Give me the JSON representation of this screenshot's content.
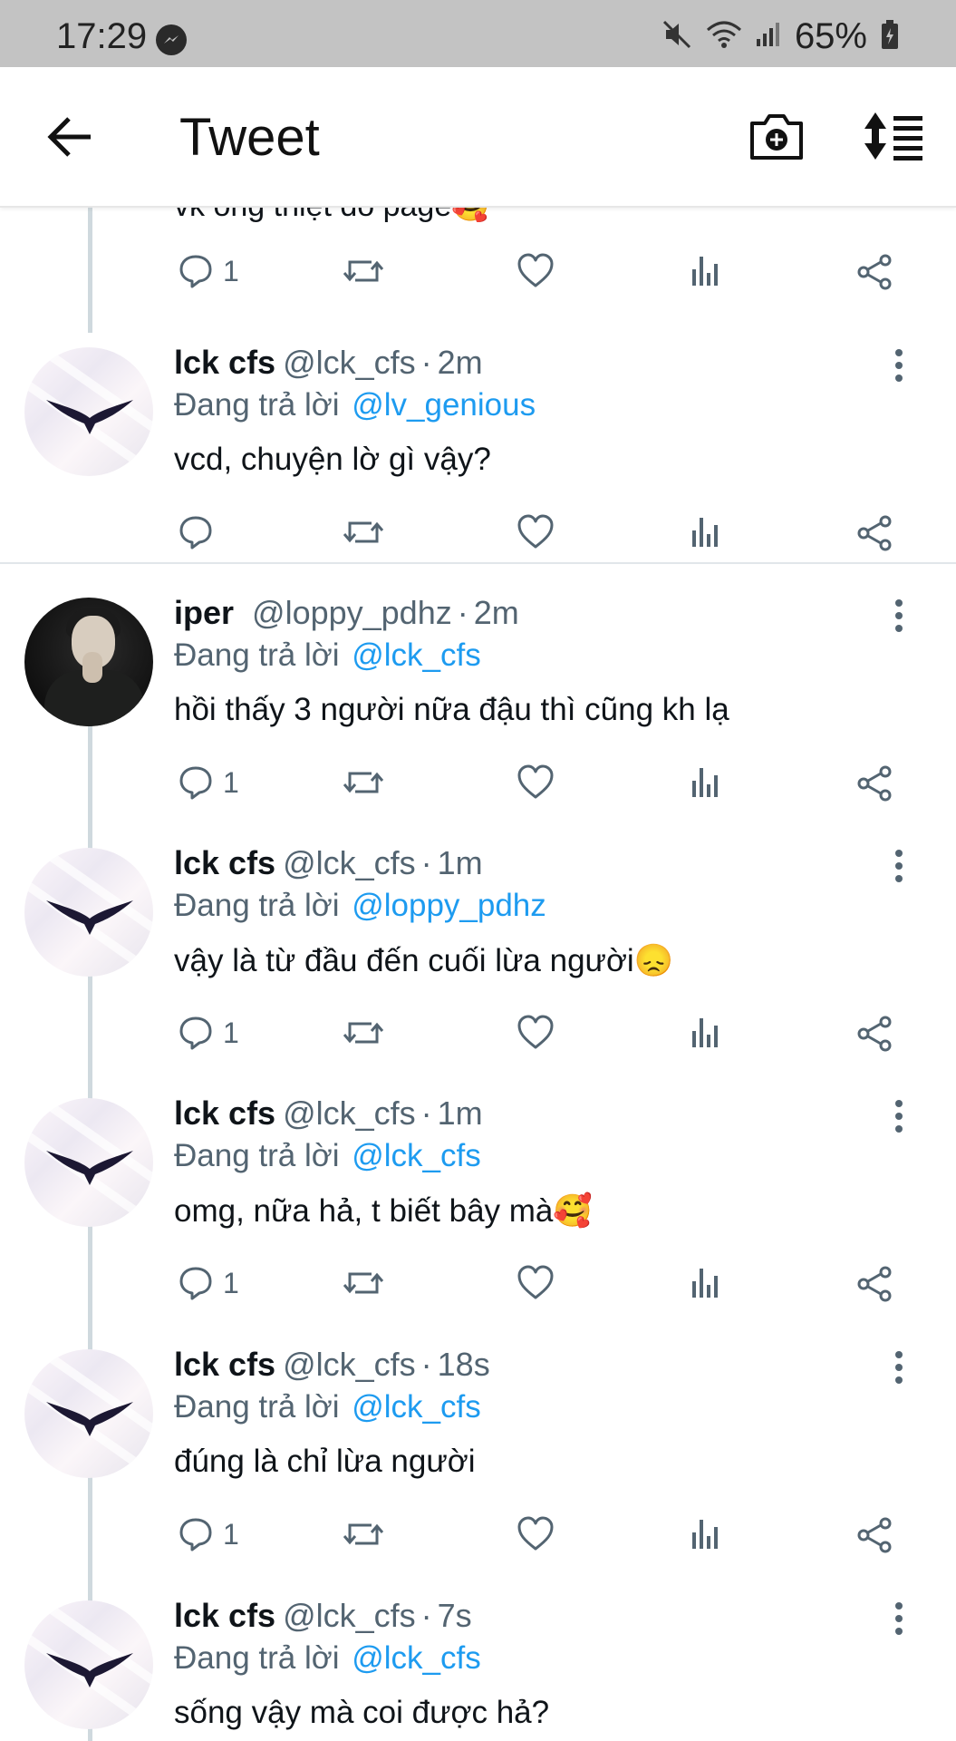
{
  "status_bar": {
    "time": "17:29",
    "battery": "65%"
  },
  "app_bar": {
    "title": "Tweet"
  },
  "partial_tweet": {
    "text": "vk ông thiệt đó page🥰",
    "replies": "1"
  },
  "tweets": [
    {
      "name": "lck cfs",
      "handle": "@lck_cfs",
      "age": "2m",
      "replying_label": "Đang trả lời",
      "mention": "@lv_genious",
      "text": "vcd, chuyện lờ gì vậy?",
      "replies": ""
    },
    {
      "name": "iper",
      "handle": "@loppy_pdhz",
      "age": "2m",
      "replying_label": "Đang trả lời",
      "mention": "@lck_cfs",
      "text": "hồi thấy 3 người nữa đậu thì cũng kh lạ",
      "replies": "1"
    },
    {
      "name": "lck cfs",
      "handle": "@lck_cfs",
      "age": "1m",
      "replying_label": "Đang trả lời",
      "mention": "@loppy_pdhz",
      "text": "vậy là từ đầu đến cuối lừa người😞",
      "replies": "1"
    },
    {
      "name": "lck cfs",
      "handle": "@lck_cfs",
      "age": "1m",
      "replying_label": "Đang trả lời",
      "mention": "@lck_cfs",
      "text": "omg, nữa hả, t biết bây mà🥰",
      "replies": "1"
    },
    {
      "name": "lck cfs",
      "handle": "@lck_cfs",
      "age": "18s",
      "replying_label": "Đang trả lời",
      "mention": "@lck_cfs",
      "text": "đúng là chỉ lừa người",
      "replies": "1"
    },
    {
      "name": "lck cfs",
      "handle": "@lck_cfs",
      "age": "7s",
      "replying_label": "Đang trả lời",
      "mention": "@lck_cfs",
      "text": "sống vậy mà coi được hả?",
      "replies": ""
    }
  ],
  "colors": {
    "accent": "#1d9bf0",
    "muted": "#536471",
    "text": "#0f1419",
    "thread_line": "#cfd9de"
  }
}
